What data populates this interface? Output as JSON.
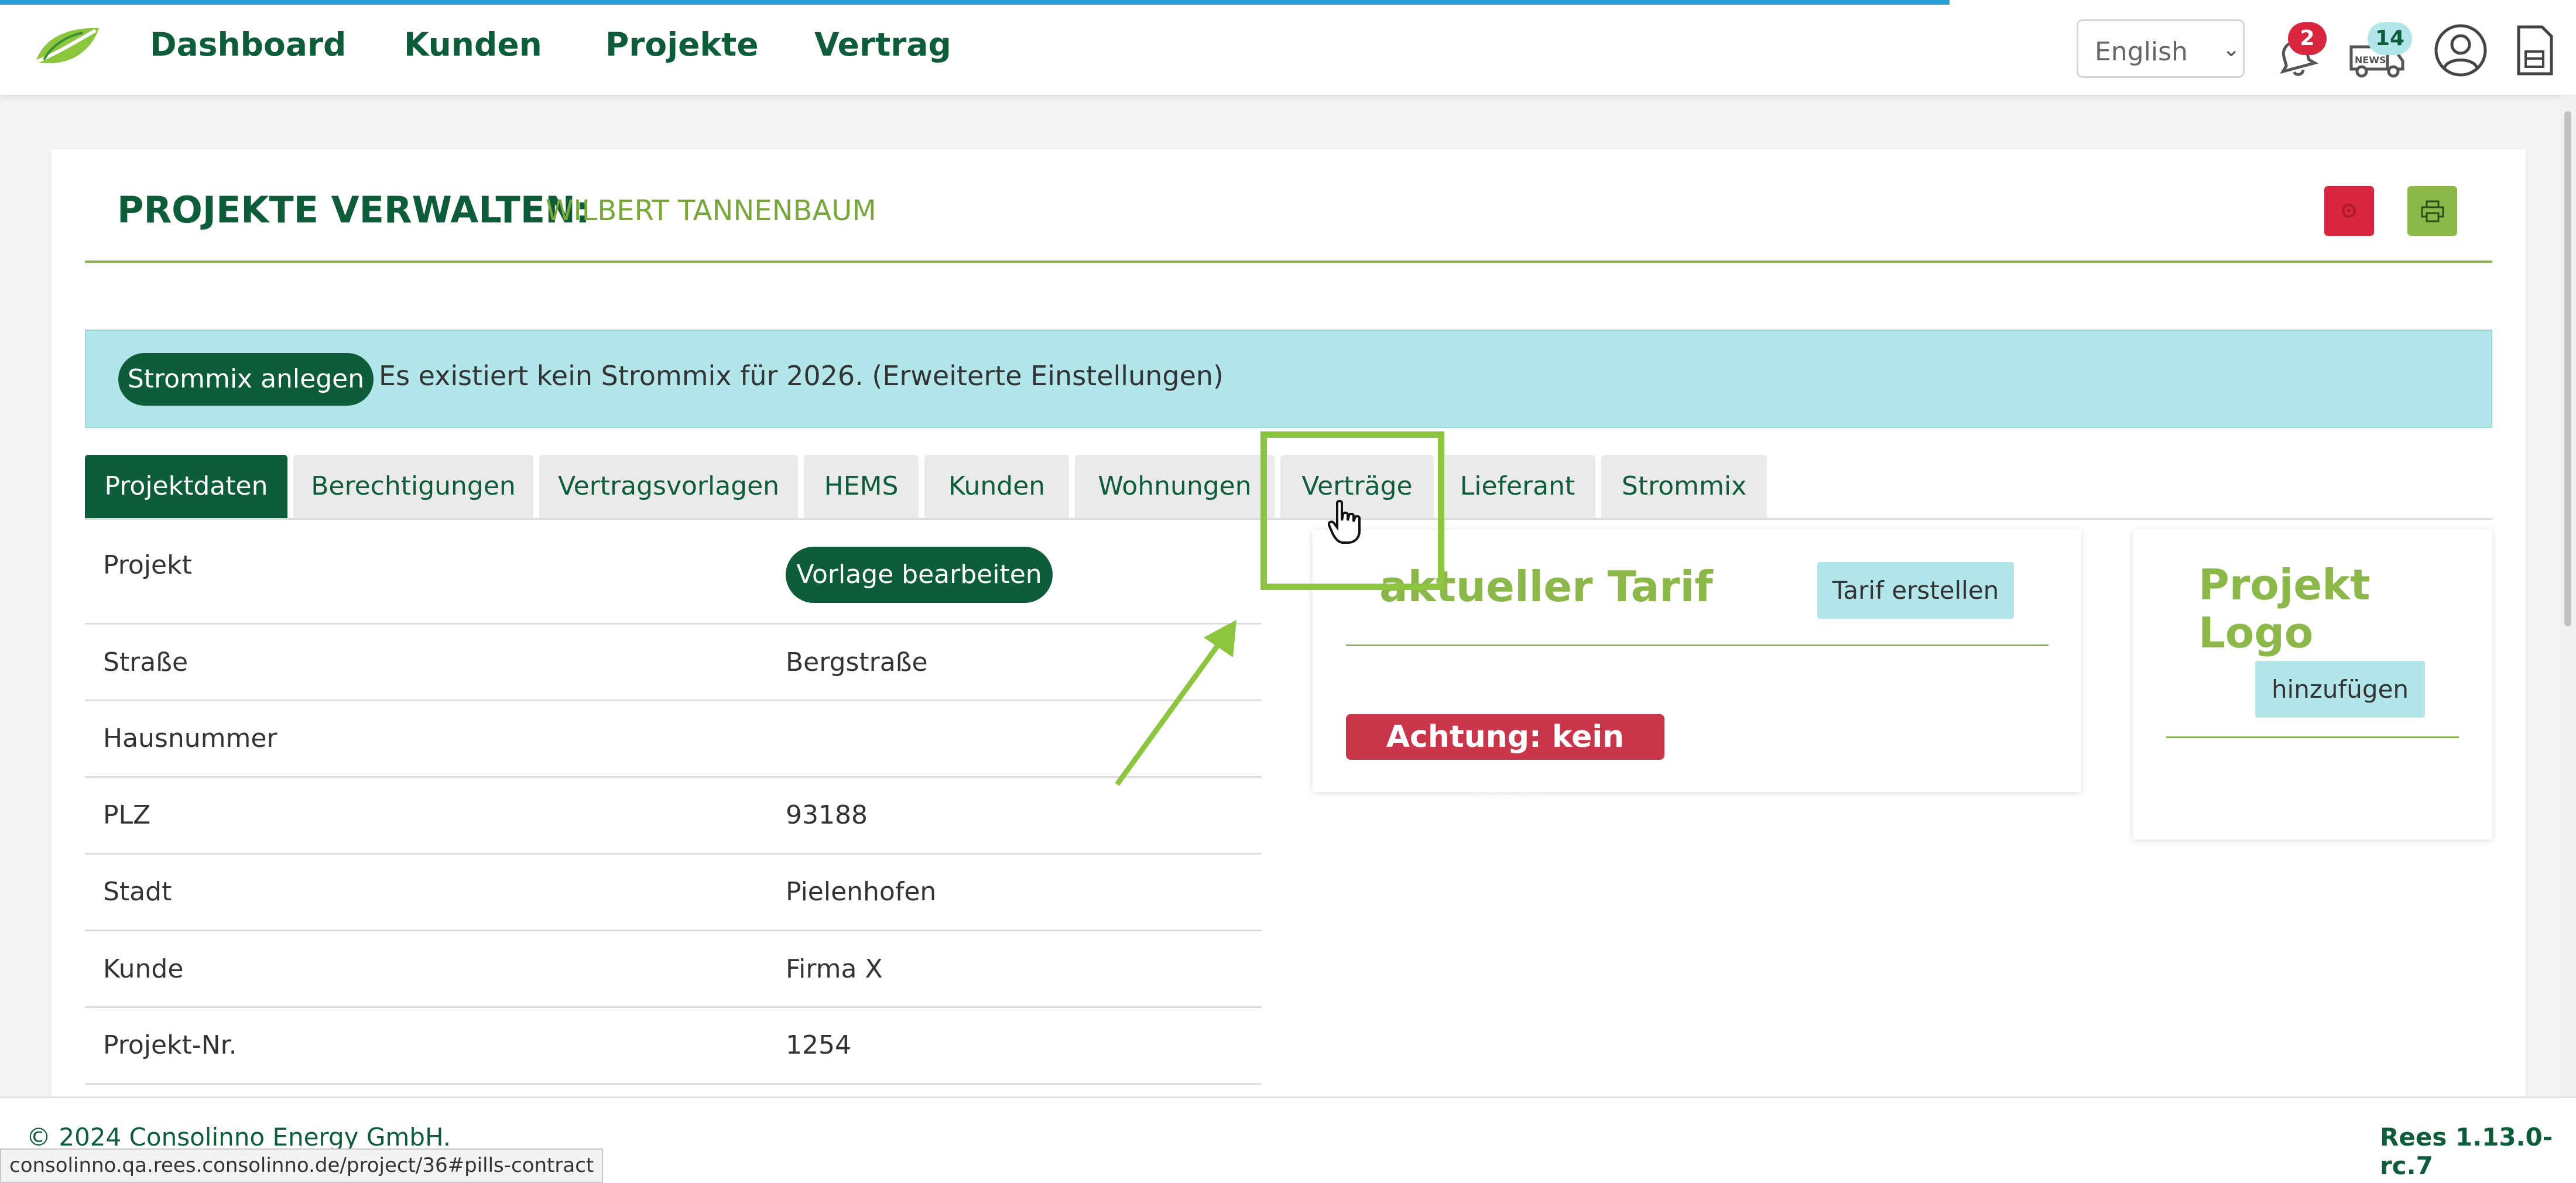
{
  "navbar": {
    "links": [
      "Dashboard",
      "Kunden",
      "Projekte",
      "Vertrag"
    ],
    "language": "English",
    "notification_count": "2",
    "news_count": "14",
    "news_label": "NEWS"
  },
  "header": {
    "title": "PROJEKTE VERWALTEN:",
    "subtitle": "WILBERT TANNENBAUM"
  },
  "banner": {
    "button_label": "Strommix anlegen",
    "text": "Es existiert kein Strommix für 2026. (Erweiterte Einstellungen)"
  },
  "tabs": [
    {
      "label": "Projektdaten",
      "active": true
    },
    {
      "label": "Berechtigungen",
      "active": false
    },
    {
      "label": "Vertragsvorlagen",
      "active": false
    },
    {
      "label": "HEMS",
      "active": false
    },
    {
      "label": "Kunden",
      "active": false
    },
    {
      "label": "Wohnungen",
      "active": false
    },
    {
      "label": "Verträge",
      "active": false
    },
    {
      "label": "Lieferant",
      "active": false
    },
    {
      "label": "Strommix",
      "active": false
    }
  ],
  "project_table": {
    "vorlage_button": "Vorlage bearbeiten",
    "rows": [
      {
        "label": "Projekt",
        "value": ""
      },
      {
        "label": "Straße",
        "value": "Bergstraße"
      },
      {
        "label": "Hausnummer",
        "value": ""
      },
      {
        "label": "PLZ",
        "value": "93188"
      },
      {
        "label": "Stadt",
        "value": "Pielenhofen"
      },
      {
        "label": "Kunde",
        "value": "Firma X"
      },
      {
        "label": "Projekt-Nr.",
        "value": "1254"
      }
    ]
  },
  "tarif_card": {
    "title": "aktueller Tarif",
    "button_label": "Tarif erstellen",
    "warning": "Achtung: kein Tarif"
  },
  "logo_card": {
    "title": "Projekt Logo",
    "button_label": "hinzufügen"
  },
  "footer": {
    "copyright": "© 2024 Consolinno Energy GmbH.",
    "version": "Rees 1.13.0-rc.7"
  },
  "status_url": "consolinno.qa.rees.consolinno.de/project/36#pills-contract",
  "colors": {
    "brand_dark_green": "#0d5c3a",
    "brand_light_green": "#8cb84a",
    "banner_cyan": "#b2e6ea",
    "danger_red": "#d7263d"
  },
  "icons": [
    "logo-leaf-icon",
    "bell-icon",
    "news-van-icon",
    "user-circle-icon",
    "document-icon",
    "settings-icon",
    "print-icon",
    "hand-cursor-icon"
  ]
}
